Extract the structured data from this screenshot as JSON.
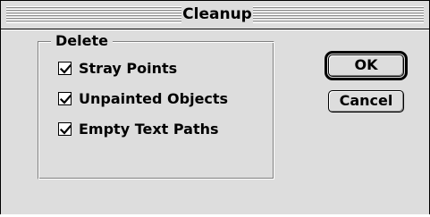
{
  "window": {
    "title": "Cleanup"
  },
  "group": {
    "label": "Delete",
    "options": [
      {
        "label": "Stray Points",
        "checked": true
      },
      {
        "label": "Unpainted Objects",
        "checked": true
      },
      {
        "label": "Empty Text Paths",
        "checked": true
      }
    ]
  },
  "buttons": {
    "ok_label": "OK",
    "cancel_label": "Cancel"
  },
  "colors": {
    "window_background": "#dddddd",
    "border": "#000000"
  },
  "icons": {
    "checkmark": "checkmark-icon"
  }
}
